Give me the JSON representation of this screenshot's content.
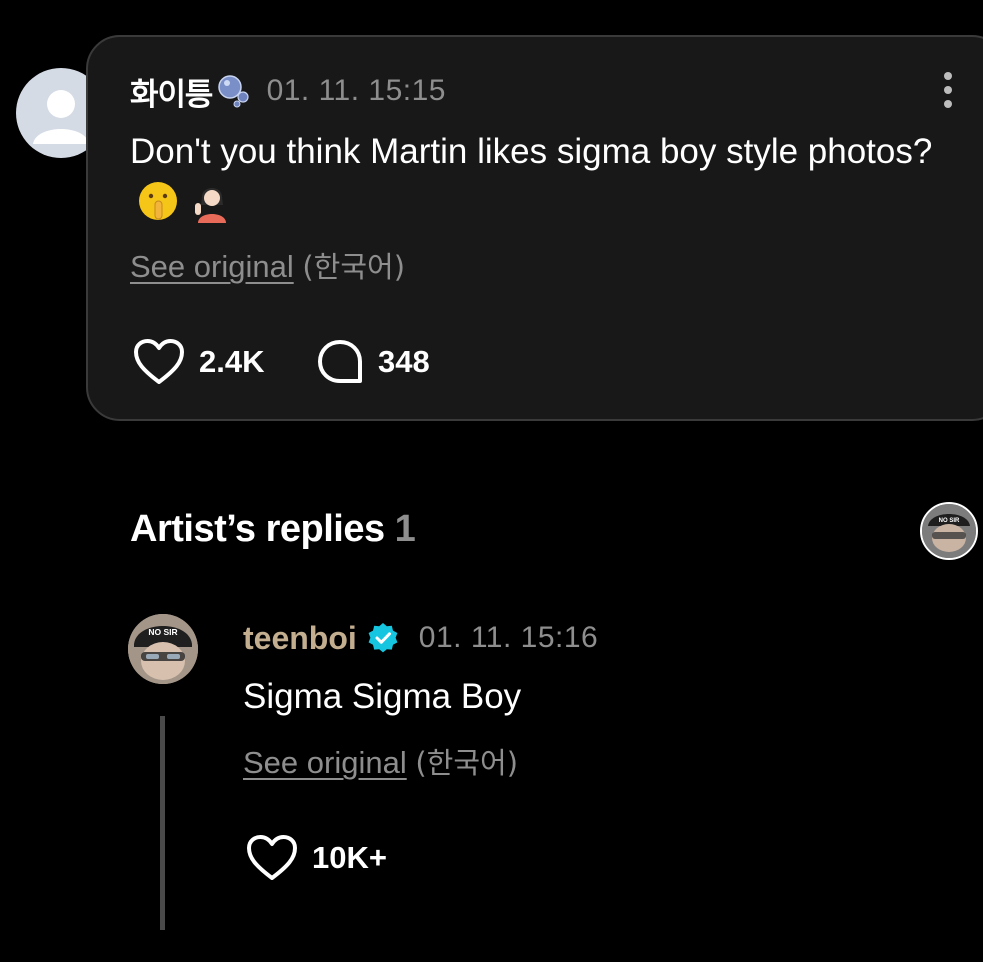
{
  "comment": {
    "username": "화이틍",
    "username_icon": "bubbles-icon",
    "timestamp": "01. 11. 15:15",
    "text": "Don't you think Martin likes sigma boy style photos?",
    "emojis": "🤫💁",
    "see_original": "See original",
    "language": "(한국어)",
    "likes": "2.4K",
    "replies": "348"
  },
  "artist_replies": {
    "heading": "Artist’s replies",
    "count": "1",
    "reply": {
      "username": "teenboi",
      "timestamp": "01. 11. 15:16",
      "text": "Sigma Sigma Boy",
      "see_original": "See original",
      "language": "(한국어)",
      "likes": "10K+",
      "avatar_cap_text": "NO SIR"
    }
  },
  "colors": {
    "background": "#000000",
    "card": "#181818",
    "muted": "#8e8e8e",
    "artist_name": "#c3ae8f",
    "verified": "#16c6e0"
  }
}
